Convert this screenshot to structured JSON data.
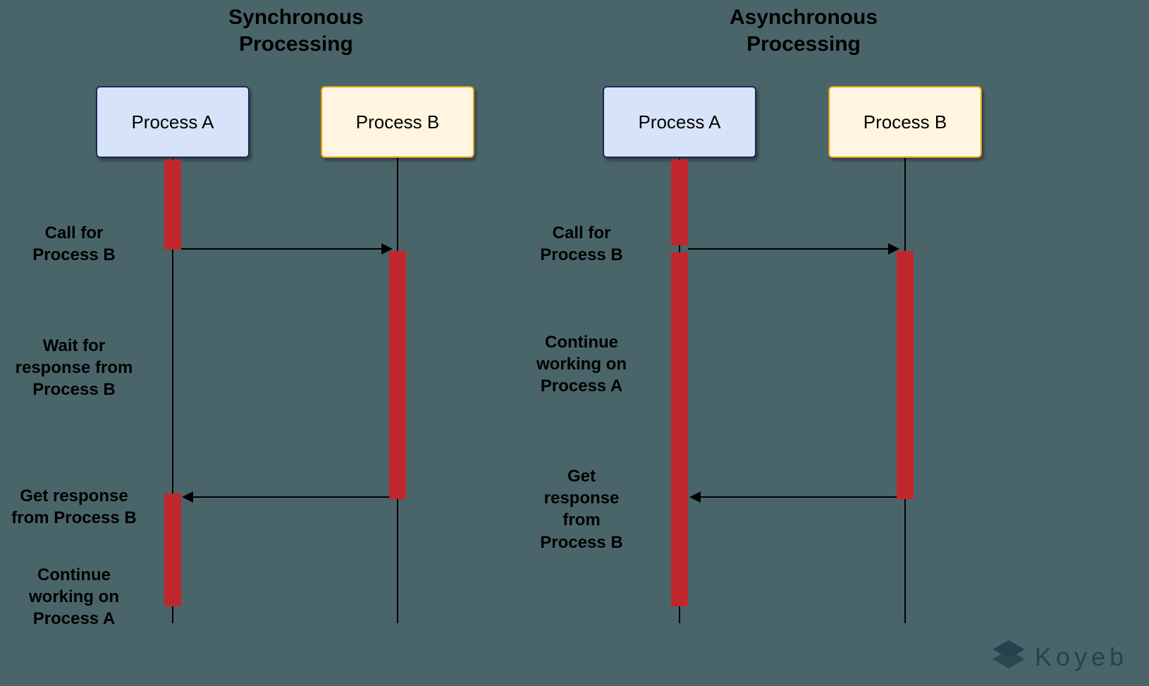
{
  "titles": {
    "sync": "Synchronous\nProcessing",
    "async": "Asynchronous\nProcessing"
  },
  "boxes": {
    "procA": "Process A",
    "procB": "Process B"
  },
  "sync_labels": {
    "call": "Call for\nProcess B",
    "wait": "Wait for\nresponse from\nProcess B",
    "get": "Get response\nfrom Process B",
    "cont": "Continue\nworking on\nProcess A"
  },
  "async_labels": {
    "call": "Call for\nProcess B",
    "cont": "Continue\nworking on\nProcess A",
    "get": "Get\nresponse\nfrom\nProcess B"
  },
  "brand": "Koyeb",
  "chart_data": {
    "type": "sequence-diagram",
    "diagrams": [
      {
        "title": "Synchronous Processing",
        "participants": [
          "Process A",
          "Process B"
        ],
        "events": [
          {
            "t": 0,
            "participant": "Process A",
            "action": "active-start"
          },
          {
            "t": 1,
            "label": "Call for Process B",
            "from": "Process A",
            "to": "Process B",
            "direction": "->"
          },
          {
            "t": 1,
            "participant": "Process A",
            "action": "active-end"
          },
          {
            "t": 1,
            "participant": "Process B",
            "action": "active-start"
          },
          {
            "t": 2,
            "label": "Wait for response from Process B",
            "participant": "Process A",
            "note": true
          },
          {
            "t": 3,
            "label": "Get response from Process B",
            "from": "Process B",
            "to": "Process A",
            "direction": "<-"
          },
          {
            "t": 3,
            "participant": "Process B",
            "action": "active-end"
          },
          {
            "t": 3,
            "participant": "Process A",
            "action": "active-start"
          },
          {
            "t": 4,
            "label": "Continue working on Process A",
            "participant": "Process A",
            "note": true
          },
          {
            "t": 5,
            "participant": "Process A",
            "action": "active-end"
          }
        ]
      },
      {
        "title": "Asynchronous Processing",
        "participants": [
          "Process A",
          "Process B"
        ],
        "events": [
          {
            "t": 0,
            "participant": "Process A",
            "action": "active-start"
          },
          {
            "t": 1,
            "label": "Call for Process B",
            "from": "Process A",
            "to": "Process B",
            "direction": "->"
          },
          {
            "t": 1,
            "participant": "Process B",
            "action": "active-start"
          },
          {
            "t": 2,
            "label": "Continue working on Process A",
            "participant": "Process A",
            "note": true
          },
          {
            "t": 3,
            "label": "Get response from Process B",
            "from": "Process B",
            "to": "Process A",
            "direction": "<-"
          },
          {
            "t": 3,
            "participant": "Process B",
            "action": "active-end"
          },
          {
            "t": 5,
            "participant": "Process A",
            "action": "active-end"
          }
        ]
      }
    ]
  }
}
